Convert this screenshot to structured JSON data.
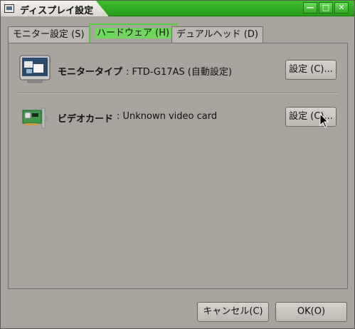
{
  "window": {
    "title": "ディスプレイ設定",
    "controls": {
      "minimize": "—",
      "maximize": "□",
      "close": "✕"
    }
  },
  "tabs": [
    {
      "label": "モニター設定 (S)",
      "active": false
    },
    {
      "label": "ハードウェア (H)",
      "active": true
    },
    {
      "label": "デュアルヘッド (D)",
      "active": false
    }
  ],
  "hardware": {
    "monitor": {
      "icon": "monitor-icon",
      "label": "モニタータイプ",
      "value": ": FTD-G17AS (自動設定)",
      "button": "設定 (C)..."
    },
    "video": {
      "icon": "video-card-icon",
      "label": "ビデオカード",
      "value": ": Unknown video card",
      "button": "設定 (C)..."
    }
  },
  "footer": {
    "cancel": "キャンセル(C)",
    "ok": "OK(O)"
  },
  "colors": {
    "titlebar": "#2faa22",
    "active_tab": "#6fd85a",
    "background": "#a8a39c"
  }
}
